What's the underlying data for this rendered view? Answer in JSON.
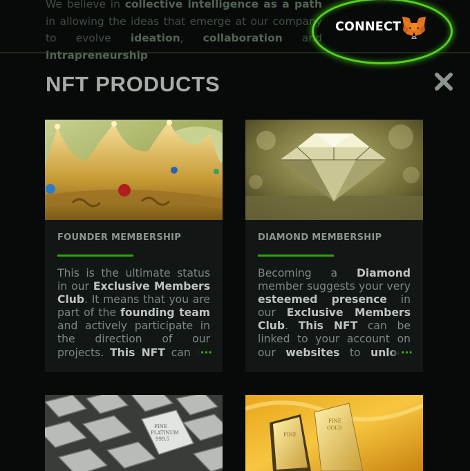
{
  "background": {
    "intro_segments": [
      {
        "t": "We believe in ",
        "b": false
      },
      {
        "t": "collective intelligence as a path",
        "b": true
      },
      {
        "t": " in allowing the ideas that emerge at our company to evolve ",
        "b": false
      },
      {
        "t": "ideation",
        "b": true
      },
      {
        "t": ", ",
        "b": false
      },
      {
        "t": "collaboration",
        "b": true
      },
      {
        "t": " and ",
        "b": false
      },
      {
        "t": "intrapreneurship",
        "b": true
      }
    ]
  },
  "header": {
    "connect_label": "CONNECT",
    "wallet_icon": "metamask-fox-icon",
    "accent_color": "#56d21f"
  },
  "modal": {
    "title": "NFT PRODUCTS",
    "close_icon": "close-icon",
    "cards": [
      {
        "name": "FOUNDER MEMBERSHIP",
        "image": "crown",
        "desc": [
          {
            "t": "This is the ultimate status in our ",
            "b": false
          },
          {
            "t": "Exclusive Members Club",
            "b": true
          },
          {
            "t": ". It means that you are part of the ",
            "b": false
          },
          {
            "t": "founding team",
            "b": true
          },
          {
            "t": " and actively participate in the direction of our projects. ",
            "b": false
          },
          {
            "t": "This NFT",
            "b": true
          },
          {
            "t": " can be linked to your account on our websites",
            "b": false
          }
        ],
        "more": "..."
      },
      {
        "name": "DIAMOND MEMBERSHIP",
        "image": "diamond",
        "desc": [
          {
            "t": "Becoming a ",
            "b": false
          },
          {
            "t": "Diamond",
            "b": true
          },
          {
            "t": " member suggests your very ",
            "b": false
          },
          {
            "t": "esteemed presence",
            "b": true
          },
          {
            "t": " in our ",
            "b": false
          },
          {
            "t": "Exclusive Members Club",
            "b": true
          },
          {
            "t": ". ",
            "b": false
          },
          {
            "t": "This NFT",
            "b": true
          },
          {
            "t": " can be linked to your account on our ",
            "b": false
          },
          {
            "t": "websites",
            "b": true
          },
          {
            "t": " to ",
            "b": false
          },
          {
            "t": "unlock perks",
            "b": true
          }
        ],
        "more": "..."
      },
      {
        "image": "platinum-bars"
      },
      {
        "image": "gold-bars"
      }
    ]
  }
}
